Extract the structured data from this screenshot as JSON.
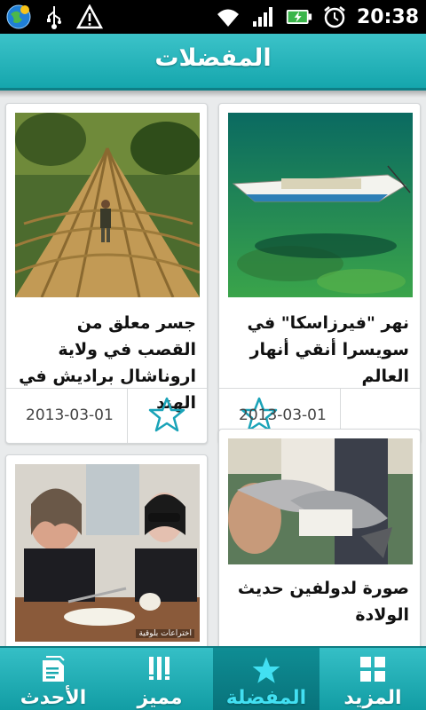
{
  "status_bar": {
    "time": "20:38",
    "icons": [
      "globe-icon",
      "usb-icon",
      "warning-icon",
      "wifi-icon",
      "signal-icon",
      "battery-charging-icon",
      "alarm-icon"
    ]
  },
  "header": {
    "title": "المفضلات"
  },
  "cards": [
    {
      "title": "نهر \"فيرزاسكا\" في سويسرا أنقي أنهار العالم",
      "date": "2013-03-01",
      "image": "boat-clear-water-photo"
    },
    {
      "title": "جسر معلق من القصب في ولاية اروناشال براديش في الهند",
      "date": "2013-03-01",
      "image": "bamboo-bridge-photo"
    },
    {
      "title": "صورة لدولفين حديث الولادة",
      "date": "",
      "image": "baby-dolphins-photo"
    },
    {
      "title": "",
      "date": "",
      "image": "chopping-onions-photo",
      "caption": "اختراعات بلوقية"
    }
  ],
  "tabs": [
    {
      "label": "المزيد",
      "icon": "grid-icon",
      "active": false
    },
    {
      "label": "المفضلة",
      "icon": "star-icon",
      "active": true
    },
    {
      "label": "مميز",
      "icon": "bars-icon",
      "active": false
    },
    {
      "label": "الأحدث",
      "icon": "document-icon",
      "active": false
    }
  ],
  "colors": {
    "accent": "#1aa9b0",
    "star": "#1aa3b8",
    "active_tab_label": "#42e0f2"
  }
}
